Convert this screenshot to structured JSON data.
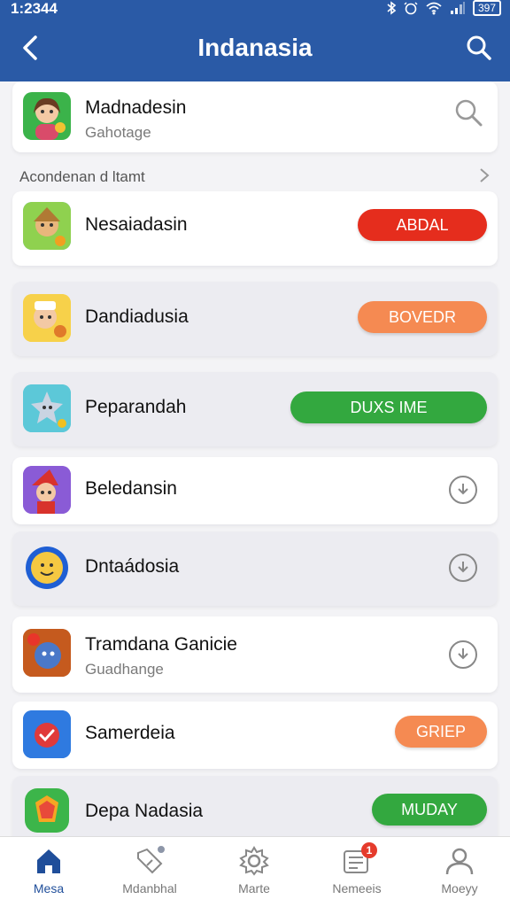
{
  "status": {
    "time": "1:2344",
    "battery": "397"
  },
  "header": {
    "title": "Indanasia"
  },
  "first_item": {
    "name": "Madnadesin",
    "subtitle": "Gahotage"
  },
  "section": {
    "title": "Acondenan d ltamt"
  },
  "items": [
    {
      "name": "Nesaiadasin",
      "button": "ABDAL",
      "button_color": "#e52d1d"
    },
    {
      "name": "Dandiadusia",
      "button": "BOVEDR",
      "button_color": "#f58a52"
    },
    {
      "name": "Peparandah",
      "button": "DUXS IME",
      "button_color": "#33a83f"
    },
    {
      "name": "Beledansin"
    },
    {
      "name": "Dntaádosia"
    },
    {
      "name": "Tramdana Ganicie",
      "subtitle": "Guadhange"
    },
    {
      "name": "Samerdeia",
      "button": "GRIEP",
      "button_color": "#f58a52"
    },
    {
      "name": "Depa Nadasia",
      "button": "MUDAY",
      "button_color": "#33a83f"
    }
  ],
  "nav": [
    {
      "label": "Mesa",
      "icon": "home-icon",
      "active": true
    },
    {
      "label": "Mdanbhal",
      "icon": "tag-icon"
    },
    {
      "label": "Marte",
      "icon": "gear-icon"
    },
    {
      "label": "Nemeeis",
      "icon": "news-icon",
      "badge": "1"
    },
    {
      "label": "Moeyy",
      "icon": "person-icon"
    }
  ]
}
